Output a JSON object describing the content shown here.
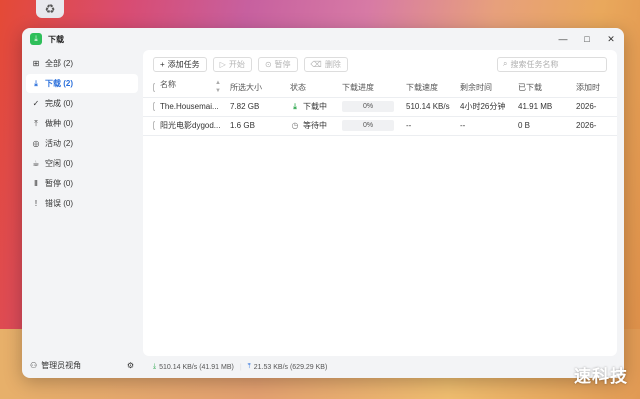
{
  "desktop": {
    "recycle_icon": "♻"
  },
  "window": {
    "title": "下载",
    "controls": {
      "minimize": "—",
      "maximize": "□",
      "close": "✕"
    }
  },
  "sidebar": {
    "items": [
      {
        "label": "全部 (2)",
        "icon": "⊞"
      },
      {
        "label": "下载 (2)",
        "icon": "⤓"
      },
      {
        "label": "完成 (0)",
        "icon": "✓"
      },
      {
        "label": "做种 (0)",
        "icon": "⤒"
      },
      {
        "label": "活动 (2)",
        "icon": "◎"
      },
      {
        "label": "空闲 (0)",
        "icon": "☕"
      },
      {
        "label": "暂停 (0)",
        "icon": "Ⅱ"
      },
      {
        "label": "错误 (0)",
        "icon": "!"
      }
    ],
    "admin_label": "管理员视角"
  },
  "toolbar": {
    "add_label": "添加任务",
    "start_label": "开始",
    "pause_label": "暂停",
    "delete_label": "删除",
    "search_placeholder": "搜索任务名称"
  },
  "table": {
    "headers": [
      "名称",
      "所选大小",
      "状态",
      "下载进度",
      "下载速度",
      "剩余时间",
      "已下载",
      "添加时"
    ],
    "rows": [
      {
        "name": "The.Housemai...",
        "size": "7.82 GB",
        "status": "下载中",
        "progress": "0%",
        "speed": "510.14 KB/s",
        "remaining": "4小时26分钟",
        "downloaded": "41.91 MB",
        "added": "2026-"
      },
      {
        "name": "阳光电影dygod...",
        "size": "1.6 GB",
        "status": "等待中",
        "progress": "0%",
        "speed": "--",
        "remaining": "--",
        "downloaded": "0 B",
        "added": "2026-"
      }
    ]
  },
  "statusbar": {
    "download": "510.14 KB/s (41.91 MB)",
    "upload": "21.53 KB/s (629.29 KB)"
  },
  "watermark": "速科技"
}
